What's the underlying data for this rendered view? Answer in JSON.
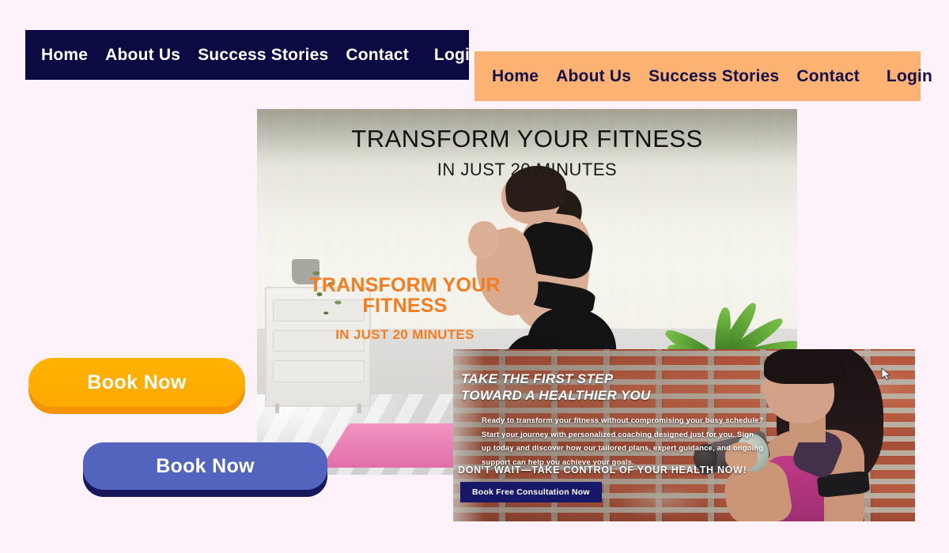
{
  "page": {
    "background_color": "#fdf1fa"
  },
  "nav_dark": {
    "background_color": "#0b0a43",
    "text_color": "#ffffff",
    "items": [
      {
        "label": "Home"
      },
      {
        "label": "About Us"
      },
      {
        "label": "Success Stories"
      },
      {
        "label": "Contact"
      },
      {
        "label": "Login"
      }
    ]
  },
  "nav_orange": {
    "background_color": "#fbb273",
    "text_color": "#13104a",
    "items": [
      {
        "label": "Home"
      },
      {
        "label": "About Us"
      },
      {
        "label": "Success Stories"
      },
      {
        "label": "Contact"
      },
      {
        "label": "Login"
      }
    ]
  },
  "hero": {
    "headline_dark": {
      "line1": "TRANSFORM YOUR FITNESS",
      "line2": "IN JUST 20 MINUTES",
      "color": "#121212"
    },
    "headline_orange": {
      "line1": "TRANSFORM YOUR FITNESS",
      "line2": "IN JUST 20 MINUTES",
      "color": "#f57c1f"
    }
  },
  "buttons": {
    "book_now_orange": {
      "label": "Book Now",
      "background_color": "#ffb302",
      "shadow_color": "#f59300",
      "text_color": "#ffffff"
    },
    "book_now_blue": {
      "label": "Book Now",
      "background_color": "#5264bd",
      "shadow_color": "#17175e",
      "text_color": "#ffffff"
    }
  },
  "brick_card": {
    "heading_line1": "TAKE THE FIRST STEP",
    "heading_line2": "TOWARD A HEALTHIER YOU",
    "body_line1": "Ready to transform your fitness without compromising your busy schedule?",
    "body_line2": "Start your journey with personalized coaching designed just for you. Sign",
    "body_line3": "up today and discover how our tailored plans, expert guidance, and ongoing",
    "body_line4": "support can help you achieve your goals.",
    "cta_line": "DON'T WAIT—TAKE CONTROL OF YOUR HEALTH NOW!",
    "button_label": "Book Free Consultation Now",
    "button_color": "#17186a",
    "text_color": "#ffffff"
  }
}
